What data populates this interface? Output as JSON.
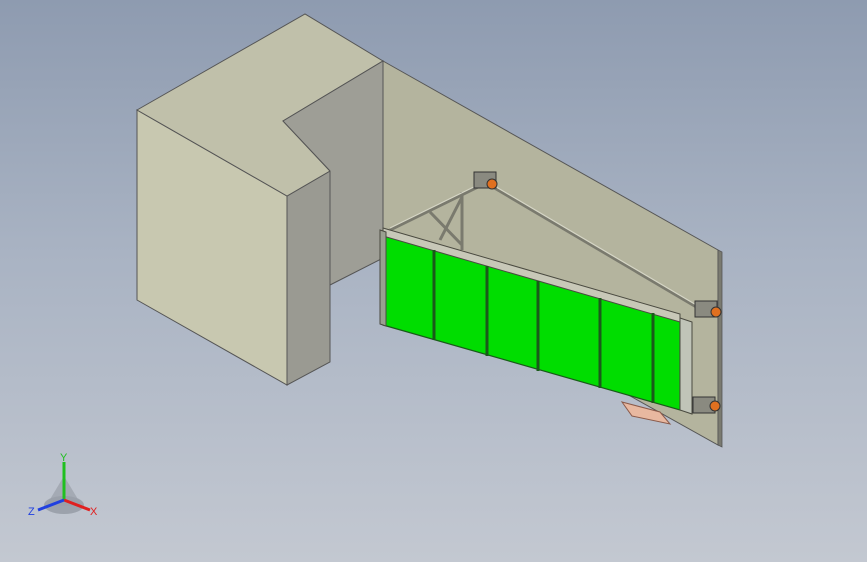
{
  "viewport": {
    "background_top": "#8e9bb0",
    "background_bottom": "#c3c8d1"
  },
  "model": {
    "colors": {
      "wall_face": "#c9c9b2",
      "wall_side": "#9a9a90",
      "wall_top": "#bfbfab",
      "panel": "#00dd00",
      "panel_edge": "#1a5a1a",
      "frame": "#b7b7a8",
      "mount_accent": "#e07020",
      "pad": "#e8b8a0"
    }
  },
  "triad": {
    "x_label": "X",
    "y_label": "Y",
    "z_label": "Z",
    "x_color": "#e02020",
    "y_color": "#20c020",
    "z_color": "#2040e0"
  }
}
